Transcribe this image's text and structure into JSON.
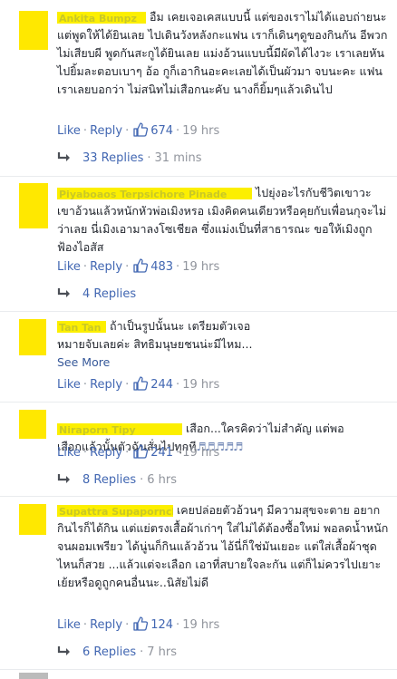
{
  "common": {
    "like_label": "Like",
    "reply_label": "Reply",
    "separator": "·"
  },
  "comments": [
    {
      "name": "Ankita Bumpz",
      "text": "อืม เคยเจอเคสแบบนี้ แต่ของเราไม่ได้แอบถ่ายนะ แต่พูดให้ได้ยินเลย ไปเดินวังหลังกะแฟน เราก็เดินๆดูของกินกัน อีพวกไม่เสียบผี พูดกันสะกูได้ยินเลย แม่งอ้วนแบบนี้มีผัดได้ไงวะ เราเลยหันไปยิ้มละตอบเบาๆ อ้อ กูก็เอากินอะคะเลยได้เป็นผัวมา จบนะคะ แฟนเราเลยบอกว่า ไม่สนิทไม่เสือกนะคับ นางก็ยิ้มๆแล้วเดินไป",
      "likes": "674",
      "time": "19 hrs",
      "replies": "33 Replies",
      "replies_time": "31 mins"
    },
    {
      "name": "Piyaboaos Terpsichore Pinade",
      "text": "ไปยุ่งอะไรกับชีวิตเขาวะ เขาอ้วนแล้วหนักหัวพ่อเมิงหรอ เมิงคิดคนเดียวหรือคุยกับเพื่อนกุจะไม่ว่าเลย นี่เมิงเอามาลงโซเชียล ซึ่งแม่งเป็นที่สาธารณะ ขอให้เมิงถูกฟ้องไอสัส",
      "likes": "483",
      "time": "19 hrs",
      "replies": "4 Replies",
      "replies_time": ""
    },
    {
      "name": "Tan Tan",
      "text": "ถ้าเป็นรูปนั้นนะ เตรียมตัวเจอหมายจับเลยค่ะ สิทธิมนุษยชนน่ะมีไหม...",
      "see_more": "See More",
      "likes": "244",
      "time": "19 hrs",
      "replies": "",
      "replies_time": ""
    },
    {
      "name": "Niraporn Tipy",
      "text": "เสือก...ใครคิดว่าไม่สำคัญ แต่พอเสือกแล้วนั้นตัวฉันสั่นไปทุกที",
      "notes": "♬♬♬♬♬",
      "likes": "241",
      "time": "19 hrs",
      "replies": "8 Replies",
      "replies_time": "6 hrs"
    },
    {
      "name": "Supattra Supapornchai",
      "text": "เคยปล่อยตัวอ้วนๆ มีความสุขจะตาย อยากกินไรก็ได้กิน แต่แย่ตรงเสื้อผ้าเก่าๆ ใส่ไม่ได้ต้องซื้อใหม่ พอลดน้ำหนักจนผอมเพรียว ได้นู่นก็กินแล้วอ้วน ไอ้นี่ก็ใช่มันเยอะ แต่ใส่เสื้อผ้าชุดไหนก็สวย ...แล้วแต่จะเลือก เอาที่สบายใจละกัน แต่ก็ไม่ควรไปเยาะเย้ยหรือดูถูกคนอื่นนะ..นิสัยไม่ดี",
      "likes": "124",
      "time": "19 hrs",
      "replies": "6 Replies",
      "replies_time": "7 hrs"
    }
  ],
  "colors": {
    "link": "#4267b2",
    "meta": "#90949c",
    "censor": "#fcef00"
  }
}
